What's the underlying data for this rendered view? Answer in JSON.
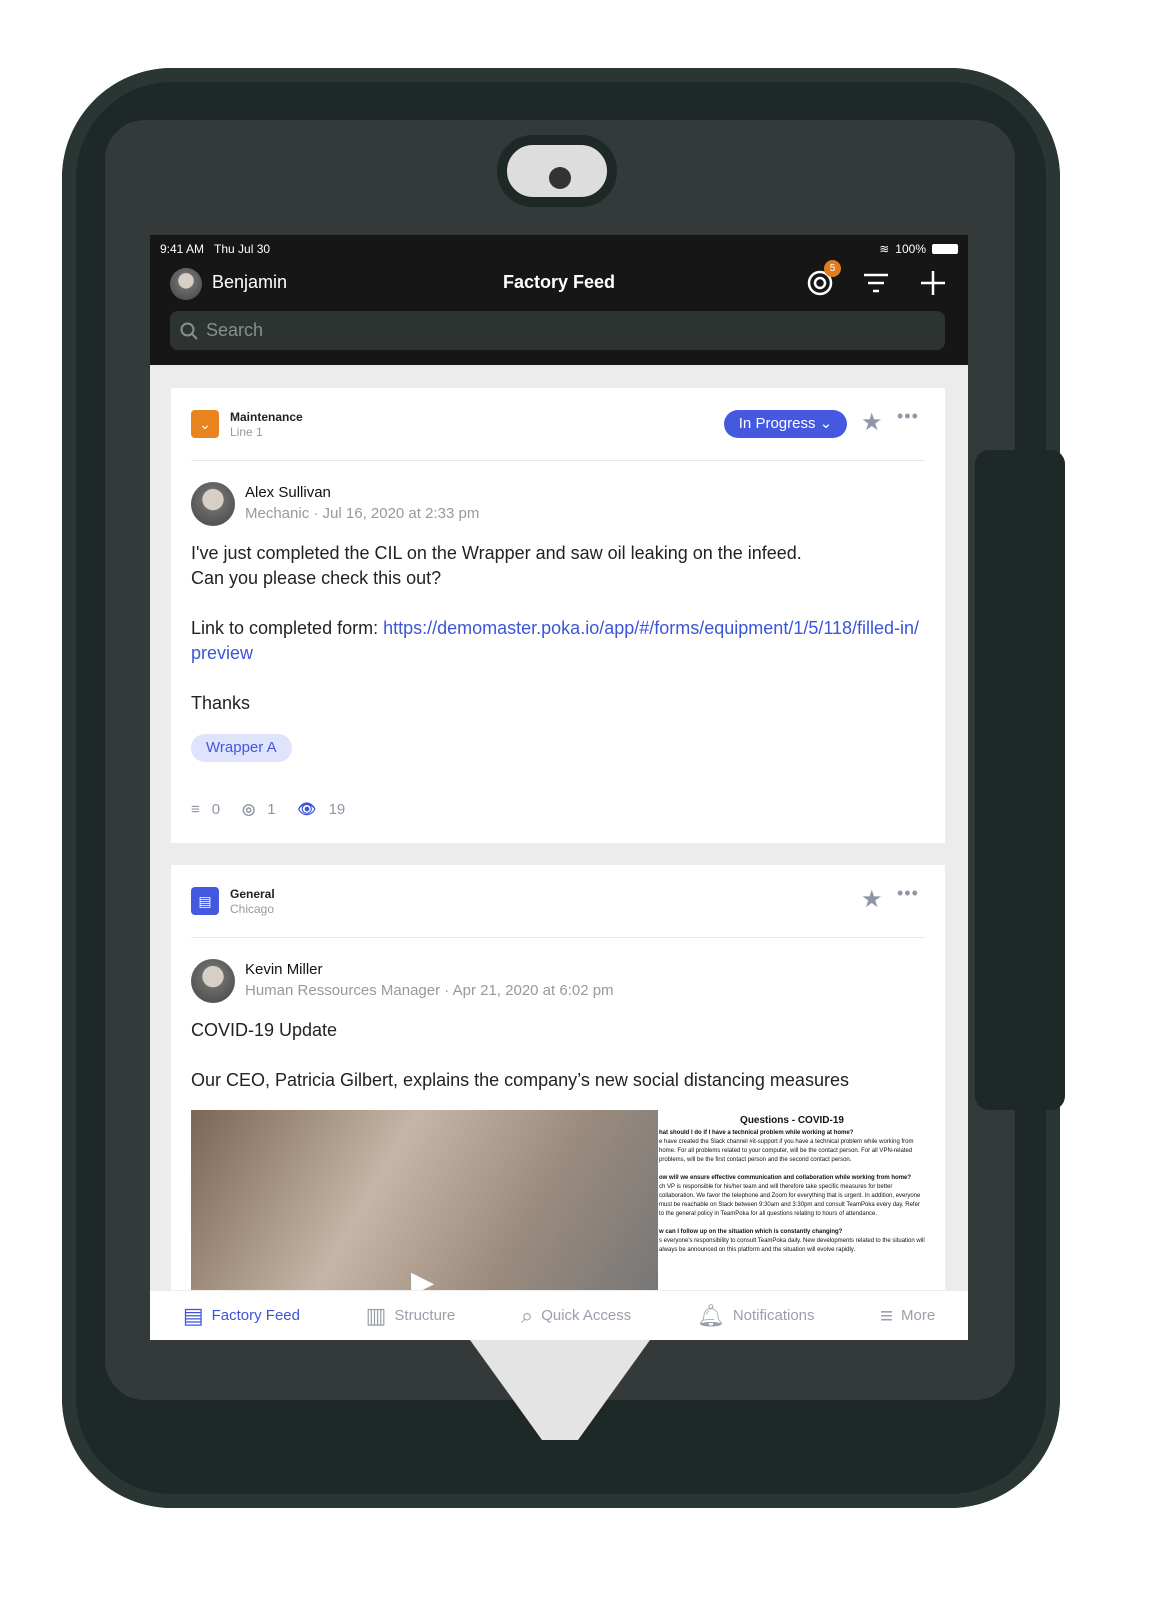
{
  "status_bar": {
    "time": "9:41 AM",
    "date": "Thu Jul 30",
    "battery": "100%"
  },
  "nav": {
    "user": "Benjamin",
    "title": "Factory Feed",
    "notification_count": "5"
  },
  "search": {
    "placeholder": "Search"
  },
  "posts": [
    {
      "category": "Maintenance",
      "subcategory": "Line 1",
      "category_color": "#e8831d",
      "status": "In Progress",
      "author": "Alex Sullivan",
      "role": "Mechanic",
      "date": "· Jul 16, 2020 at 2:33 pm",
      "line1": "I've just completed the CIL on the Wrapper and saw oil leaking on the infeed.",
      "line2": "Can you please check this out?",
      "link_prefix": "Link to completed form: ",
      "link": "https://demomaster.poka.io/app/#/forms/equipment/1/5/118/filled-in/preview",
      "thanks": "Thanks",
      "tag": "Wrapper A",
      "comments": "0",
      "mentions": "1",
      "views": "19"
    },
    {
      "category": "General",
      "subcategory": "Chicago",
      "category_color": "#4458e0",
      "author": "Kevin Miller",
      "role": "Human Ressources Manager",
      "date": "· Apr 21, 2020 at 6:02 pm",
      "title": "COVID-19 Update",
      "text": "Our CEO, Patricia Gilbert, explains the company’s new social distancing measures",
      "doc": {
        "title": "Questions - COVID-19",
        "q1": "hat should I do if I have a technical problem while working at home?",
        "a1": "e have created the Slack channel #it-support if you have a technical problem while working from home. For all problems related to your computer, will be the contact person. For all VPN-related problems, will be the first contact person and the second contact person.",
        "q2": "ow will we ensure effective communication and collaboration while working from home?",
        "a2": "ch VP is responsible for his/her team and will therefore take specific measures for better collaboration. We favor the telephone and Zoom for everything that is urgent. In addition, everyone must be reachable on Slack between 9:30am and 3:30pm and consult TeamPoka every day. Refer to the general policy in TeamPoka for all questions relating to hours of attendance.",
        "q3": "w can I follow up on the situation which is constantly changing?",
        "a3": "s everyone's responsibility to consult TeamPoka daily. New developments related to the situation will always be announced on this platform and the situation will evolve rapidly."
      }
    }
  ],
  "tabs": [
    {
      "label": "Factory Feed",
      "active": true
    },
    {
      "label": "Structure"
    },
    {
      "label": "Quick Access"
    },
    {
      "label": "Notifications"
    },
    {
      "label": "More"
    }
  ],
  "colors": {
    "accent": "#4458e0",
    "case": "#1e2826",
    "nav": "#161616"
  }
}
